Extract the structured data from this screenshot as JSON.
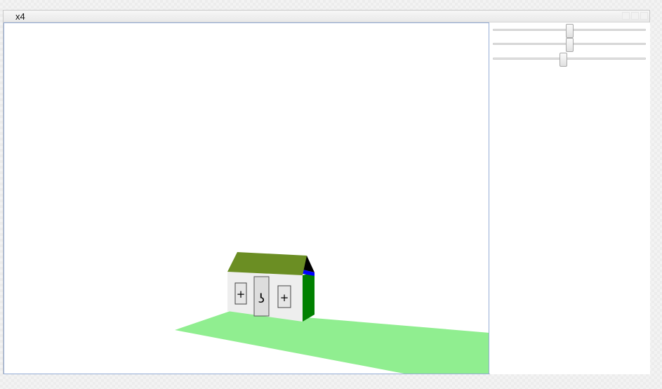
{
  "window": {
    "title": "x4"
  },
  "sliders": [
    {
      "name": "slider-1",
      "value": 0.5
    },
    {
      "name": "slider-2",
      "value": 0.5
    },
    {
      "name": "slider-3",
      "value": 0.46
    }
  ],
  "scene": {
    "colors": {
      "background": "#ffffff",
      "ground": "#90ee90",
      "roof_front": "#6b8e23",
      "roof_gable": "#000000",
      "roof_edge": "#0000ff",
      "wall_front": "#eeeeee",
      "wall_side": "#008000",
      "door": "#dddddd",
      "window": "#e6e6e6"
    },
    "window_glyph": "+",
    "door_glyph": "ʖ"
  }
}
